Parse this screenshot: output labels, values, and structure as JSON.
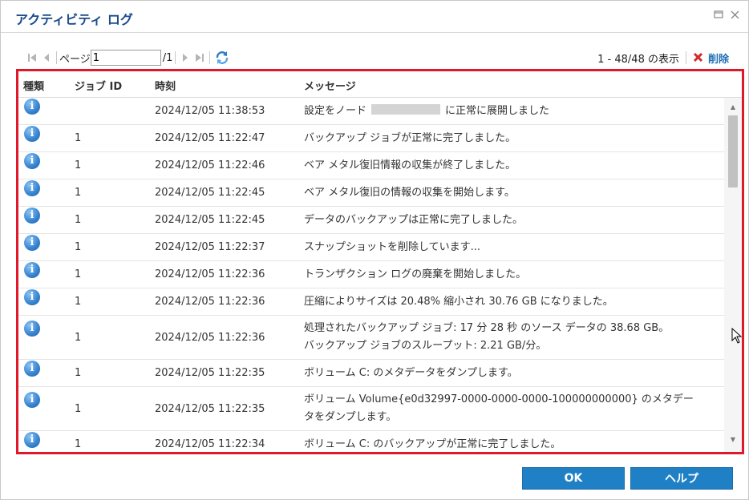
{
  "dialog": {
    "title": "アクティビティ ログ"
  },
  "toolbar": {
    "page_label": "ページ",
    "page_value": "1",
    "page_total": "/1",
    "display_count": "1 - 48/48 の表示",
    "delete_label": "削除"
  },
  "grid": {
    "columns": [
      "種類",
      "ジョブ ID",
      "時刻",
      "メッセージ"
    ],
    "rows": [
      {
        "job_id": "",
        "time": "2024/12/05 11:38:53",
        "message": "設定をノード",
        "message_suffix": "に正常に展開しました"
      },
      {
        "job_id": "1",
        "time": "2024/12/05 11:22:47",
        "message": "バックアップ ジョブが正常に完了しました。"
      },
      {
        "job_id": "1",
        "time": "2024/12/05 11:22:46",
        "message": "ベア メタル復旧情報の収集が終了しました。"
      },
      {
        "job_id": "1",
        "time": "2024/12/05 11:22:45",
        "message": "ベア メタル復旧の情報の収集を開始します。"
      },
      {
        "job_id": "1",
        "time": "2024/12/05 11:22:45",
        "message": "データのバックアップは正常に完了しました。"
      },
      {
        "job_id": "1",
        "time": "2024/12/05 11:22:37",
        "message": "スナップショットを削除しています..."
      },
      {
        "job_id": "1",
        "time": "2024/12/05 11:22:36",
        "message": "トランザクション ログの廃棄を開始しました。"
      },
      {
        "job_id": "1",
        "time": "2024/12/05 11:22:36",
        "message": "圧縮によりサイズは 20.48% 縮小され 30.76 GB になりました。"
      },
      {
        "job_id": "1",
        "time": "2024/12/05 11:22:36",
        "message": "処理されたバックアップ ジョブ: 17 分 28 秒 のソース データの 38.68 GB。",
        "message_line2": "バックアップ ジョブのスループット: 2.21 GB/分。"
      },
      {
        "job_id": "1",
        "time": "2024/12/05 11:22:35",
        "message": "ボリューム C: のメタデータをダンプします。"
      },
      {
        "job_id": "1",
        "time": "2024/12/05 11:22:35",
        "message": "ボリューム Volume{e0d32997-0000-0000-0000-100000000000} のメタデー",
        "message_line2": "タをダンプします。"
      },
      {
        "job_id": "1",
        "time": "2024/12/05 11:22:34",
        "message": "ボリューム C: のバックアップが正常に完了しました。"
      }
    ]
  },
  "footer": {
    "ok_label": "OK",
    "help_label": "ヘルプ"
  },
  "colors": {
    "title": "#1a4b8c",
    "accent_button": "#1f80c6",
    "highlight_border": "#e0192a",
    "delete_icon": "#d12b2b"
  }
}
